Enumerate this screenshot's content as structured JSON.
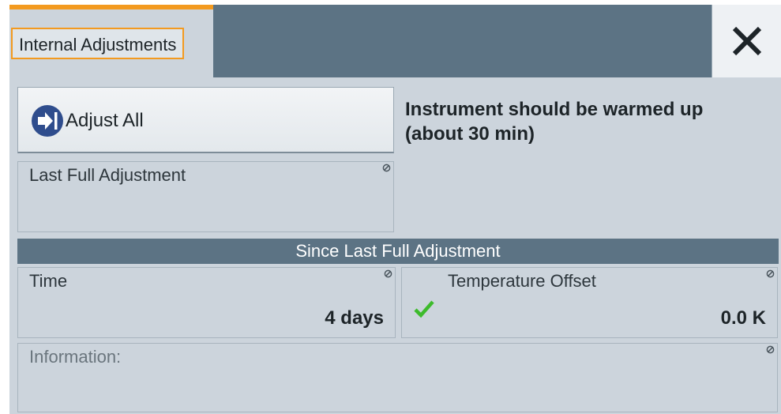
{
  "dialog": {
    "tab_label": "Internal Adjustments",
    "close_icon": "close-x-icon"
  },
  "adjust": {
    "button_label": "Adjust All",
    "button_icon": "arrow-right-to-bar-icon",
    "warmup_line1": "Instrument should be warmed up",
    "warmup_line2": "(about 30 min)",
    "last_full_label": "Last Full Adjustment",
    "last_full_value": ""
  },
  "since": {
    "header": "Since Last Full Adjustment",
    "time_label": "Time",
    "time_value": "4 days",
    "temp_label": "Temperature Offset",
    "temp_value": "0.0 K",
    "temp_status_icon": "green-check-icon"
  },
  "info": {
    "label": "Information:",
    "value": ""
  },
  "colors": {
    "accent": "#f39a1f",
    "header_bar": "#5c7384",
    "panel_bg": "#ccd4dc",
    "button_icon_bg": "#2f4d8d",
    "status_ok": "#3dbb2c"
  }
}
